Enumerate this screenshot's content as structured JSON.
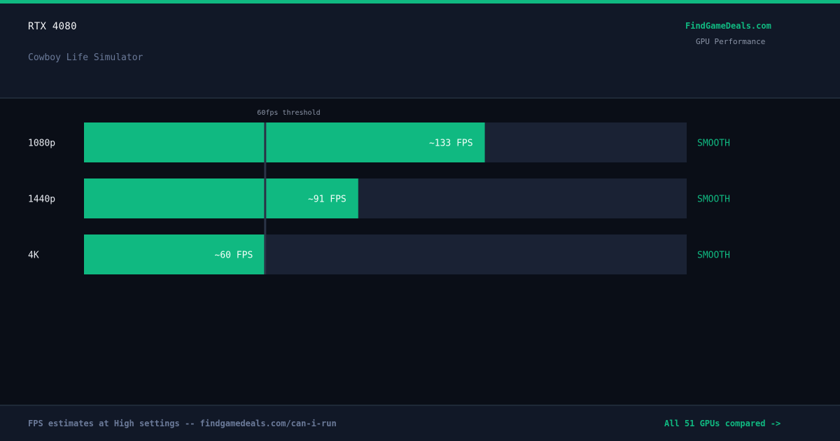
{
  "header": {
    "gpu": "RTX 4080",
    "game": "Cowboy Life Simulator",
    "brand": "FindGameDeals.com",
    "brand_sub": "GPU Performance"
  },
  "footer": {
    "note": "FPS estimates at High settings -- findgamedeals.com/can-i-run",
    "link": "All 51 GPUs compared ->"
  },
  "colors": {
    "accent": "#10b981",
    "track": "#1a2234",
    "threshold": "#2a3346",
    "status": "#10b981"
  },
  "chart_data": {
    "type": "bar",
    "orientation": "horizontal",
    "categories": [
      "1080p",
      "1440p",
      "4K"
    ],
    "values": [
      133,
      91,
      60
    ],
    "value_labels": [
      "~133 FPS",
      "~91 FPS",
      "~60 FPS"
    ],
    "status": [
      "SMOOTH",
      "SMOOTH",
      "SMOOTH"
    ],
    "xlim": [
      0,
      200
    ],
    "threshold": {
      "value": 60,
      "label": "60fps threshold"
    },
    "grid": false
  }
}
